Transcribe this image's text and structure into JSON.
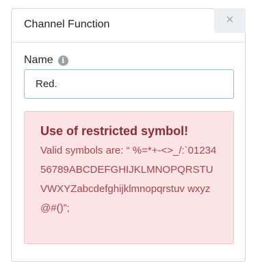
{
  "dialog": {
    "title": "Channel Function",
    "close_glyph": "×"
  },
  "form": {
    "name_label": "Name",
    "info_glyph": "i",
    "name_value": "Red."
  },
  "error": {
    "title": "Use of restricted symbol!",
    "message": "Valid symbols are: “ %=*+-<>_/:`0123456789ABCDEFGHIJKLMNOPQRSTUVWXYZabcdefghijklmnopqrstuv wxyz@#()”;"
  },
  "icons": {
    "close": "close-icon",
    "info": "info-icon"
  },
  "colors": {
    "error_background": "#fce4e6",
    "error_title": "#8e2a33",
    "error_text": "#a6444c",
    "input_focus_border": "#88bfe0"
  }
}
